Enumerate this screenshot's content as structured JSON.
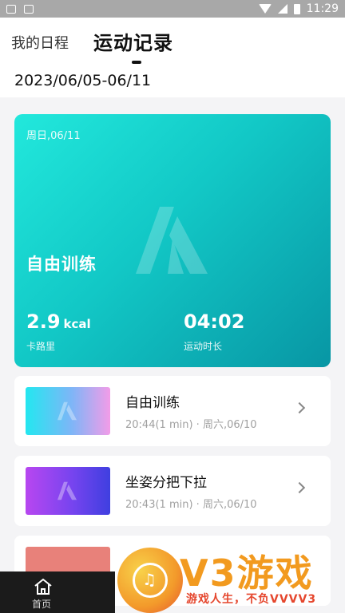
{
  "status_bar": {
    "time": "11:29"
  },
  "header": {
    "tab_schedule": "我的日程",
    "tab_records": "运动记录",
    "date_range": "2023/06/05-06/11"
  },
  "hero": {
    "date": "周日,06/11",
    "title": "自由训练",
    "calories_value": "2.9",
    "calories_unit": "kcal",
    "calories_label": "卡路里",
    "duration_value": "04:02",
    "duration_label": "运动时长",
    "gradient": [
      "#22e8dc",
      "#0896a4"
    ]
  },
  "records": [
    {
      "title": "自由训练",
      "time": "20:44(1 min)",
      "sep": "·",
      "day": "周六,06/10"
    },
    {
      "title": "坐姿分把下拉",
      "time": "20:43(1 min)",
      "sep": "·",
      "day": "周六,06/10"
    },
    {
      "title": "",
      "time": "",
      "sep": "",
      "day": ""
    }
  ],
  "bottom_nav": {
    "home_label": "首页"
  },
  "watermark": {
    "brand": "V3游戏",
    "slogan": "游戏人生，不负VVVV3"
  }
}
